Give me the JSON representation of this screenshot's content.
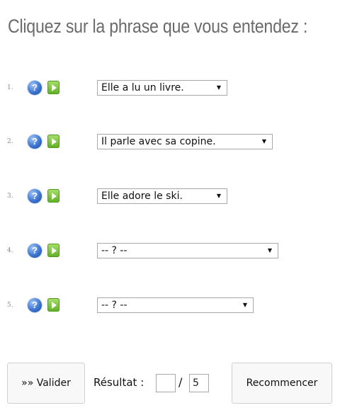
{
  "title": "Cliquez sur la phrase que vous entendez :",
  "items": [
    {
      "number": "1.",
      "help_icon": "question-icon",
      "play_icon": "play-icon",
      "selected": "Elle a lu un livre."
    },
    {
      "number": "2.",
      "help_icon": "question-icon",
      "play_icon": "play-icon",
      "selected": "Il parle avec sa copine."
    },
    {
      "number": "3.",
      "help_icon": "question-icon",
      "play_icon": "play-icon",
      "selected": "Elle adore le ski."
    },
    {
      "number": "4.",
      "help_icon": "question-icon",
      "play_icon": "play-icon",
      "selected": "-- ? --"
    },
    {
      "number": "5.",
      "help_icon": "question-icon",
      "play_icon": "play-icon",
      "selected": "-- ? --"
    }
  ],
  "footer": {
    "validate_label": "»» Valider",
    "result_label": "Résultat :",
    "score_value": "",
    "slash": "/",
    "total_value": "5",
    "restart_label": "Recommencer"
  },
  "colors": {
    "title": "#6b6b6b",
    "help_icon": "#3c74d1",
    "play_icon": "#5fae23"
  }
}
